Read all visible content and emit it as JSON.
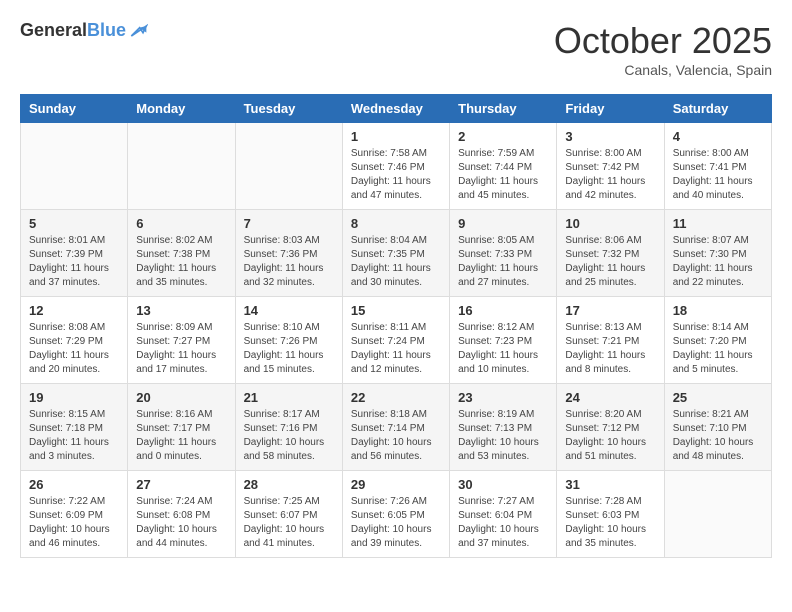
{
  "header": {
    "logo_line1": "General",
    "logo_line2": "Blue",
    "month": "October 2025",
    "location": "Canals, Valencia, Spain"
  },
  "weekdays": [
    "Sunday",
    "Monday",
    "Tuesday",
    "Wednesday",
    "Thursday",
    "Friday",
    "Saturday"
  ],
  "weeks": [
    [
      {
        "day": "",
        "info": ""
      },
      {
        "day": "",
        "info": ""
      },
      {
        "day": "",
        "info": ""
      },
      {
        "day": "1",
        "info": "Sunrise: 7:58 AM\nSunset: 7:46 PM\nDaylight: 11 hours and 47 minutes."
      },
      {
        "day": "2",
        "info": "Sunrise: 7:59 AM\nSunset: 7:44 PM\nDaylight: 11 hours and 45 minutes."
      },
      {
        "day": "3",
        "info": "Sunrise: 8:00 AM\nSunset: 7:42 PM\nDaylight: 11 hours and 42 minutes."
      },
      {
        "day": "4",
        "info": "Sunrise: 8:00 AM\nSunset: 7:41 PM\nDaylight: 11 hours and 40 minutes."
      }
    ],
    [
      {
        "day": "5",
        "info": "Sunrise: 8:01 AM\nSunset: 7:39 PM\nDaylight: 11 hours and 37 minutes."
      },
      {
        "day": "6",
        "info": "Sunrise: 8:02 AM\nSunset: 7:38 PM\nDaylight: 11 hours and 35 minutes."
      },
      {
        "day": "7",
        "info": "Sunrise: 8:03 AM\nSunset: 7:36 PM\nDaylight: 11 hours and 32 minutes."
      },
      {
        "day": "8",
        "info": "Sunrise: 8:04 AM\nSunset: 7:35 PM\nDaylight: 11 hours and 30 minutes."
      },
      {
        "day": "9",
        "info": "Sunrise: 8:05 AM\nSunset: 7:33 PM\nDaylight: 11 hours and 27 minutes."
      },
      {
        "day": "10",
        "info": "Sunrise: 8:06 AM\nSunset: 7:32 PM\nDaylight: 11 hours and 25 minutes."
      },
      {
        "day": "11",
        "info": "Sunrise: 8:07 AM\nSunset: 7:30 PM\nDaylight: 11 hours and 22 minutes."
      }
    ],
    [
      {
        "day": "12",
        "info": "Sunrise: 8:08 AM\nSunset: 7:29 PM\nDaylight: 11 hours and 20 minutes."
      },
      {
        "day": "13",
        "info": "Sunrise: 8:09 AM\nSunset: 7:27 PM\nDaylight: 11 hours and 17 minutes."
      },
      {
        "day": "14",
        "info": "Sunrise: 8:10 AM\nSunset: 7:26 PM\nDaylight: 11 hours and 15 minutes."
      },
      {
        "day": "15",
        "info": "Sunrise: 8:11 AM\nSunset: 7:24 PM\nDaylight: 11 hours and 12 minutes."
      },
      {
        "day": "16",
        "info": "Sunrise: 8:12 AM\nSunset: 7:23 PM\nDaylight: 11 hours and 10 minutes."
      },
      {
        "day": "17",
        "info": "Sunrise: 8:13 AM\nSunset: 7:21 PM\nDaylight: 11 hours and 8 minutes."
      },
      {
        "day": "18",
        "info": "Sunrise: 8:14 AM\nSunset: 7:20 PM\nDaylight: 11 hours and 5 minutes."
      }
    ],
    [
      {
        "day": "19",
        "info": "Sunrise: 8:15 AM\nSunset: 7:18 PM\nDaylight: 11 hours and 3 minutes."
      },
      {
        "day": "20",
        "info": "Sunrise: 8:16 AM\nSunset: 7:17 PM\nDaylight: 11 hours and 0 minutes."
      },
      {
        "day": "21",
        "info": "Sunrise: 8:17 AM\nSunset: 7:16 PM\nDaylight: 10 hours and 58 minutes."
      },
      {
        "day": "22",
        "info": "Sunrise: 8:18 AM\nSunset: 7:14 PM\nDaylight: 10 hours and 56 minutes."
      },
      {
        "day": "23",
        "info": "Sunrise: 8:19 AM\nSunset: 7:13 PM\nDaylight: 10 hours and 53 minutes."
      },
      {
        "day": "24",
        "info": "Sunrise: 8:20 AM\nSunset: 7:12 PM\nDaylight: 10 hours and 51 minutes."
      },
      {
        "day": "25",
        "info": "Sunrise: 8:21 AM\nSunset: 7:10 PM\nDaylight: 10 hours and 48 minutes."
      }
    ],
    [
      {
        "day": "26",
        "info": "Sunrise: 7:22 AM\nSunset: 6:09 PM\nDaylight: 10 hours and 46 minutes."
      },
      {
        "day": "27",
        "info": "Sunrise: 7:24 AM\nSunset: 6:08 PM\nDaylight: 10 hours and 44 minutes."
      },
      {
        "day": "28",
        "info": "Sunrise: 7:25 AM\nSunset: 6:07 PM\nDaylight: 10 hours and 41 minutes."
      },
      {
        "day": "29",
        "info": "Sunrise: 7:26 AM\nSunset: 6:05 PM\nDaylight: 10 hours and 39 minutes."
      },
      {
        "day": "30",
        "info": "Sunrise: 7:27 AM\nSunset: 6:04 PM\nDaylight: 10 hours and 37 minutes."
      },
      {
        "day": "31",
        "info": "Sunrise: 7:28 AM\nSunset: 6:03 PM\nDaylight: 10 hours and 35 minutes."
      },
      {
        "day": "",
        "info": ""
      }
    ]
  ]
}
